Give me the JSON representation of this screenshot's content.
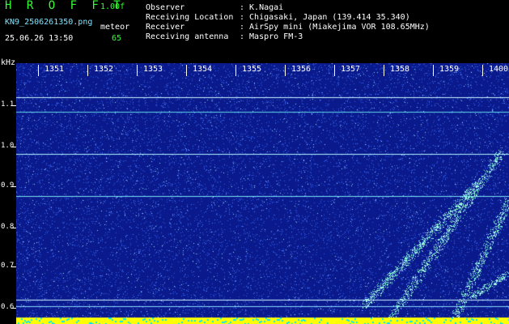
{
  "header": {
    "title": "H R O F F T",
    "version": "1.00f",
    "filename": "KN9_2506261350.png",
    "datetime": "25.06.26 13:50",
    "meteor_label": "meteor",
    "meteor_count": "65"
  },
  "info": [
    {
      "label": "Observer",
      "value": ": K.Nagai"
    },
    {
      "label": "Receiving Location",
      "value": ": Chigasaki, Japan (139.414 35.340)"
    },
    {
      "label": "Receiver",
      "value": ": AirSpy mini (Miakejima VOR 108.65MHz)"
    },
    {
      "label": "Receiving antenna",
      "value": ": Maspro FM-3"
    }
  ],
  "axes": {
    "y_unit": "kHz",
    "x_ticks": [
      "1351",
      "1352",
      "1353",
      "1354",
      "1355",
      "1356",
      "1357",
      "1358",
      "1359",
      "1400"
    ],
    "y_ticks": [
      "1.1",
      "1.0",
      "0.9",
      "0.8",
      "0.7",
      "0.6"
    ]
  },
  "colors": {
    "background": "#0a1a8c",
    "noise": "#4f7dff",
    "carrier": "#9ff0ff",
    "meteor": "#7fffd4",
    "baseline": "#ffff00",
    "accent": "#33ff33"
  }
}
